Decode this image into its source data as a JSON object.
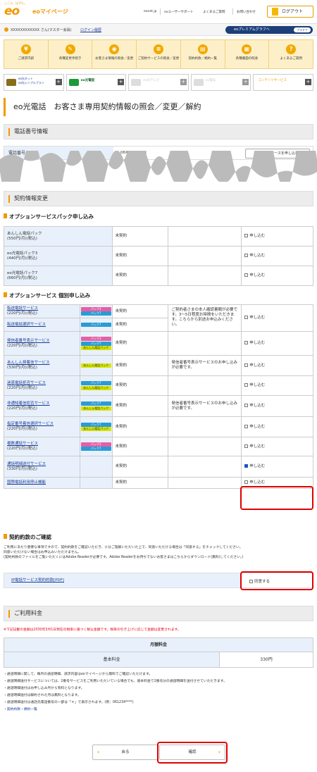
{
  "header": {
    "tagline": "こころ、はずむ。",
    "logo": "eo",
    "service": "eoマイページ",
    "links": [
      "eonet.jp",
      "eoユーザーサポート",
      "よくあるご質問",
      "お問い合わせ"
    ],
    "logout": "ログアウト"
  },
  "user": {
    "name": "XXXXXXXXXXXX さん(マスター会員)",
    "history": "ログイン履歴",
    "premium": "eoプレミアムグラフへ",
    "plan": "プラチナ"
  },
  "menu": [
    {
      "label": "ご請求内訳",
      "icon": "yen-icon",
      "glyph": "¥"
    },
    {
      "label": "各種変更手続き",
      "icon": "edit-icon",
      "glyph": "✎"
    },
    {
      "label": "お客さま情報の照会／変更",
      "icon": "person-icon",
      "glyph": "◉"
    },
    {
      "label": "ご契約サービスの照会／変更",
      "icon": "list-icon",
      "glyph": "≡"
    },
    {
      "label": "契約約款／規約一覧",
      "icon": "document-icon",
      "glyph": "▤"
    },
    {
      "label": "各種書面の照会",
      "icon": "document-icon",
      "glyph": "▦"
    },
    {
      "label": "よくあるご質問",
      "icon": "question-icon",
      "glyph": "?"
    }
  ],
  "tabs": [
    {
      "label1": "eo光ネット",
      "label2": "eo光シンプルプラン",
      "disabled": false
    },
    {
      "label1": "eo光電話",
      "label2": "",
      "disabled": false
    },
    {
      "label1": "eo光テレビ",
      "label2": "",
      "disabled": true
    },
    {
      "label1": "eo電気",
      "label2": "",
      "disabled": true
    },
    {
      "label1": "コンテンツサービス",
      "label2": "",
      "disabled": false
    }
  ],
  "page_title": "eo光電話　お客さま専用契約情報の照会／変更／解約",
  "sec_phone": "電話番号情報",
  "phone": {
    "label": "電話番号",
    "value": "06XXXXXXXX",
    "course_btn": "電話番号コースを申し込む"
  },
  "sec_contract": "契約情報変更",
  "pack_heading": "オプションサービスパック申し込み",
  "packs": [
    {
      "name": "あんしん電話パック\n(550円/月)(税込)",
      "status": "未契約",
      "note": "",
      "action": "申し込む",
      "checked": false
    },
    {
      "name": "eo光電話パック3\n(440円/月)(税込)",
      "status": "未契約",
      "note": "",
      "action": "申し込む",
      "checked": false
    },
    {
      "name": "eo光電話パック7\n(660円/月)(税込)",
      "status": "未契約",
      "note": "",
      "action": "申し込む",
      "checked": false
    }
  ],
  "indiv_heading": "オプションサービス 個別申し込み",
  "options": [
    {
      "name": "転送電話サービス",
      "price": "(220円/月)(税込)",
      "tags": [
        "パック3",
        "パック7"
      ],
      "status": "未契約",
      "action": "申し込む",
      "checked": false
    },
    {
      "name": "転送電話選択サービス",
      "price": "",
      "tags": [
        "パック7"
      ],
      "status": "未契約",
      "action": "",
      "checked": false
    },
    {
      "name": "発信者番号表示サービス",
      "price": "(220円/月)(税込)",
      "tags": [
        "パック3",
        "パック7",
        "あんしん電話パック"
      ],
      "status": "未契約",
      "action": "申し込む",
      "checked": false
    },
    {
      "name": "あんしん発着信サービス",
      "price": "(330円/月)(税込)",
      "tags": [
        "あんしん電話パック"
      ],
      "status": "未契約",
      "action": "申し込む",
      "checked": false
    },
    {
      "name": "迷惑電話拒否サービス",
      "price": "(220円/月)(税込)",
      "tags": [
        "パック7",
        "あんしん電話パック"
      ],
      "status": "未契約",
      "action": "申し込む",
      "checked": false
    },
    {
      "name": "非通知着信拒否サービス",
      "price": "(220円/月)(税込)",
      "tags": [
        "パック7",
        "あんしん電話パック"
      ],
      "status": "未契約",
      "action": "申し込む",
      "checked": false
    },
    {
      "name": "指定番号着信選択サービス",
      "price": "(220円/月)(税込)",
      "tags": [
        "パック7",
        "あんしん電話パック"
      ],
      "status": "未契約",
      "action": "申し込む",
      "checked": false
    },
    {
      "name": "複数通話サービス",
      "price": "(220円/月)(税込)",
      "tags": [
        "パック3",
        "パック7"
      ],
      "status": "未契約",
      "action": "申し込む",
      "checked": false
    },
    {
      "name": "通話明細送付サービス",
      "price": "(330円/月)(税込)",
      "tags": [],
      "status": "未契約",
      "action": "申し込む",
      "checked": true
    },
    {
      "name": "国際電話利用停止機能",
      "price": "",
      "tags": [],
      "status": "未契約",
      "action": "申し込む",
      "checked": false
    }
  ],
  "notes": {
    "forward": "ご契約者さまの本人確認書類が必要です。3～5日程度お時間をいただきます。こちらから別途お申込みください。",
    "caller_id_1": "発信者番号表示サービスのお申し込みが必要です。",
    "caller_id_2": "発信者番号表示サービスのお申し込みが必要です。"
  },
  "terms_heading": "契約約款のご確認",
  "terms_text1": "ご利用にあたり重要な事項ですので、契約約款をご確認いただき、十分ご理解いただいた上で、同意いただける場合は「同意する」をチェックしてください。",
  "terms_text2": "同意いただけない場合はお申込みいただけません。",
  "terms_text3": "(契約約款のファイルをご覧いただくにはAdobe Readerが必要です。Adobe Readerをお持ちでないお客さまはこちらからダウンロード(無料)してください。)",
  "terms": {
    "link": "IP電話サービス契約約款[PDF]",
    "agree": "同意する",
    "checked": false
  },
  "sec_fee": "ご利用料金",
  "fee_note": "※下記記載の金額は2030年3月1日現在の税率に基づく税込金額です。税率の引き上げに応じて金額は変更されます。",
  "fee": {
    "header": "月額料金",
    "label": "基本料金",
    "value": "330円"
  },
  "bullets": [
    "・通話明細に関して、毎月の通話明細、請求内容はeoマイページから無料でご確認いただけます。",
    "・通話明細送付サービスについては、2番号サービスをご利用いただいている場合でも、基本料金で2番号分の通話明細を送付させていただきます。",
    "・通話明細送付はお申し込み月から有料となります。",
    "・通話明細送付は解約された月は無料となります。",
    "・通話明細送付は通話先電話番号の一部は「＊」で表示されます。(例：061234****)"
  ],
  "bullet_link": "・契約約款・規約一覧",
  "buttons": {
    "back": "戻る",
    "confirm": "確認"
  }
}
